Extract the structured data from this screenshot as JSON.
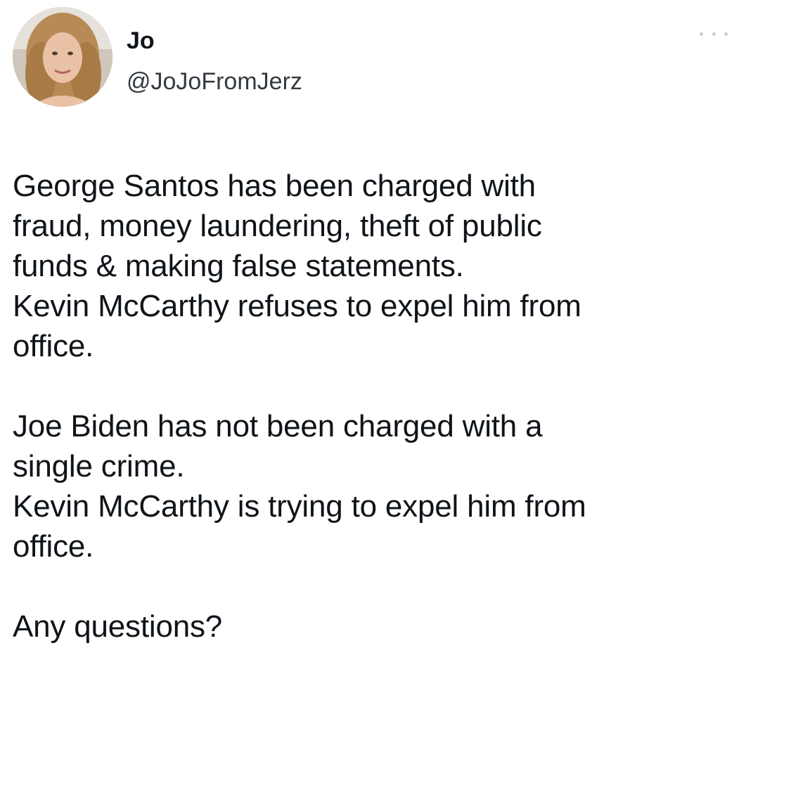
{
  "user": {
    "display_name": "Jo",
    "handle": "@JoJoFromJerz",
    "avatar_icon": "profile-photo"
  },
  "menu_icon": "more-options-icon",
  "tweet": {
    "paragraph1": [
      "George Santos has been charged with",
      "fraud, money laundering, theft of public",
      "funds & making false statements.",
      "Kevin McCarthy refuses to expel him from",
      "office."
    ],
    "paragraph2": [
      "Joe Biden has not been charged with a",
      "single crime.",
      "Kevin McCarthy is trying to expel him from",
      "office."
    ],
    "paragraph3": [
      "Any questions?"
    ]
  }
}
